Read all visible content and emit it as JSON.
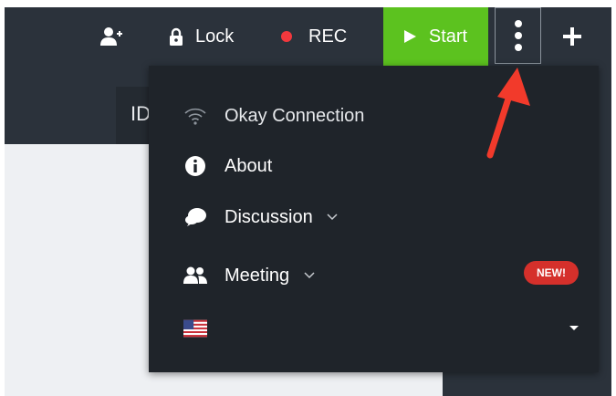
{
  "toolbar": {
    "lock_label": "Lock",
    "rec_label": "REC",
    "start_label": "Start",
    "icons": {
      "add_user": "add-user-icon",
      "lock": "lock-icon",
      "rec": "rec-dot-icon",
      "start": "play-icon",
      "more": "kebab-menu-icon",
      "plus": "plus-icon"
    }
  },
  "background_tab": {
    "label": "ID"
  },
  "menu": {
    "connection_label": "Okay Connection",
    "about_label": "About",
    "discussion_label": "Discussion",
    "meeting_label": "Meeting",
    "new_badge": "NEW!",
    "language_flag": "us-flag-icon"
  },
  "colors": {
    "toolbar_bg": "#2b323b",
    "menu_bg": "#1f242a",
    "start_green": "#5cc21f",
    "rec_red": "#f2383d",
    "badge_red": "#d5302b",
    "annotation_arrow": "#f23a2b"
  }
}
